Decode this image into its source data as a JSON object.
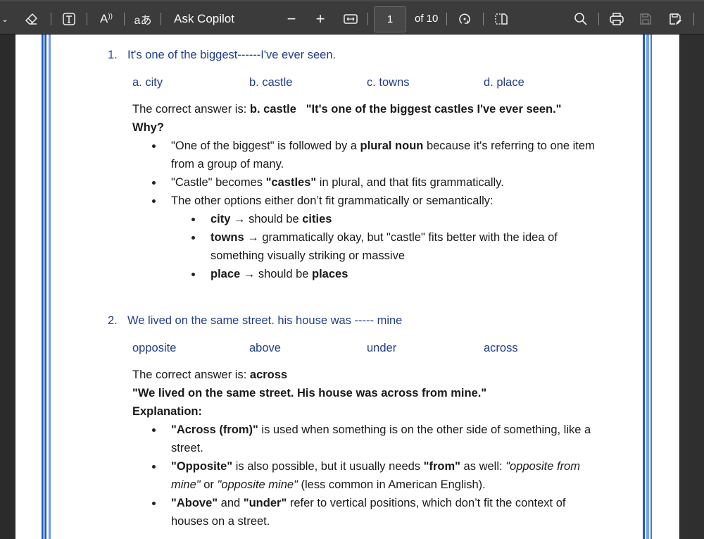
{
  "toolbar": {
    "ask_copilot": "Ask Copilot",
    "page_number": "1",
    "page_total": "of 10"
  },
  "colors": {
    "question_blue": "#1f3d8a",
    "border_dark": "#1f5bbf",
    "border_light": "#6f9be0"
  },
  "q1": {
    "number": "1.",
    "text": "It's one of the biggest------I've ever seen.",
    "options": [
      "a. city",
      "b. castle",
      "c. towns",
      "d. place"
    ],
    "answer": [
      {
        "t": "The correct answer is: "
      },
      {
        "t": "b. castle",
        "b": true
      },
      {
        "t": "   "
      },
      {
        "t": "\"It's one of the biggest castles I've ever seen.\"",
        "b": true
      }
    ],
    "why": "Why?",
    "bullets": [
      [
        {
          "t": "\"One of the biggest\" is followed by a "
        },
        {
          "t": "plural noun",
          "b": true
        },
        {
          "t": " because it's referring to one item from a group of many."
        }
      ],
      [
        {
          "t": "\"Castle\" becomes "
        },
        {
          "t": "\"castles\"",
          "b": true
        },
        {
          "t": " in plural, and that fits grammatically."
        }
      ],
      [
        {
          "t": "The other options either don’t fit grammatically or semantically:"
        }
      ]
    ],
    "sub_bullets": [
      [
        {
          "t": "city",
          "b": true
        },
        {
          "t": " → should be "
        },
        {
          "t": "cities",
          "b": true
        }
      ],
      [
        {
          "t": "towns",
          "b": true
        },
        {
          "t": " → grammatically okay, but \"castle\" fits better with the idea of something visually striking or massive"
        }
      ],
      [
        {
          "t": "place",
          "b": true
        },
        {
          "t": " → should be "
        },
        {
          "t": "places",
          "b": true
        }
      ]
    ]
  },
  "q2": {
    "number": "2.",
    "text": "We lived on the same street. his house was ----- mine",
    "options": [
      "opposite",
      "above",
      "under",
      "across"
    ],
    "answer": [
      {
        "t": "The correct answer is: "
      },
      {
        "t": "across",
        "b": true
      }
    ],
    "sentence": "\"We lived on the same street. His house was across from mine.\"",
    "explanation": "Explanation:",
    "bullets": [
      [
        {
          "t": "\"Across (from)\"",
          "b": true
        },
        {
          "t": " is used when something is on the other side of something, like a street."
        }
      ],
      [
        {
          "t": "\"Opposite\"",
          "b": true
        },
        {
          "t": " is also possible, but it usually needs "
        },
        {
          "t": "\"from\"",
          "b": true
        },
        {
          "t": " as well: "
        },
        {
          "t": "\"opposite from mine\"",
          "i": true
        },
        {
          "t": " or "
        },
        {
          "t": "\"opposite mine\"",
          "i": true
        },
        {
          "t": " (less common in American English)."
        }
      ],
      [
        {
          "t": "\"Above\"",
          "b": true
        },
        {
          "t": " and "
        },
        {
          "t": "\"under\"",
          "b": true
        },
        {
          "t": " refer to vertical positions, which don’t fit the context of houses on a street."
        }
      ]
    ]
  }
}
